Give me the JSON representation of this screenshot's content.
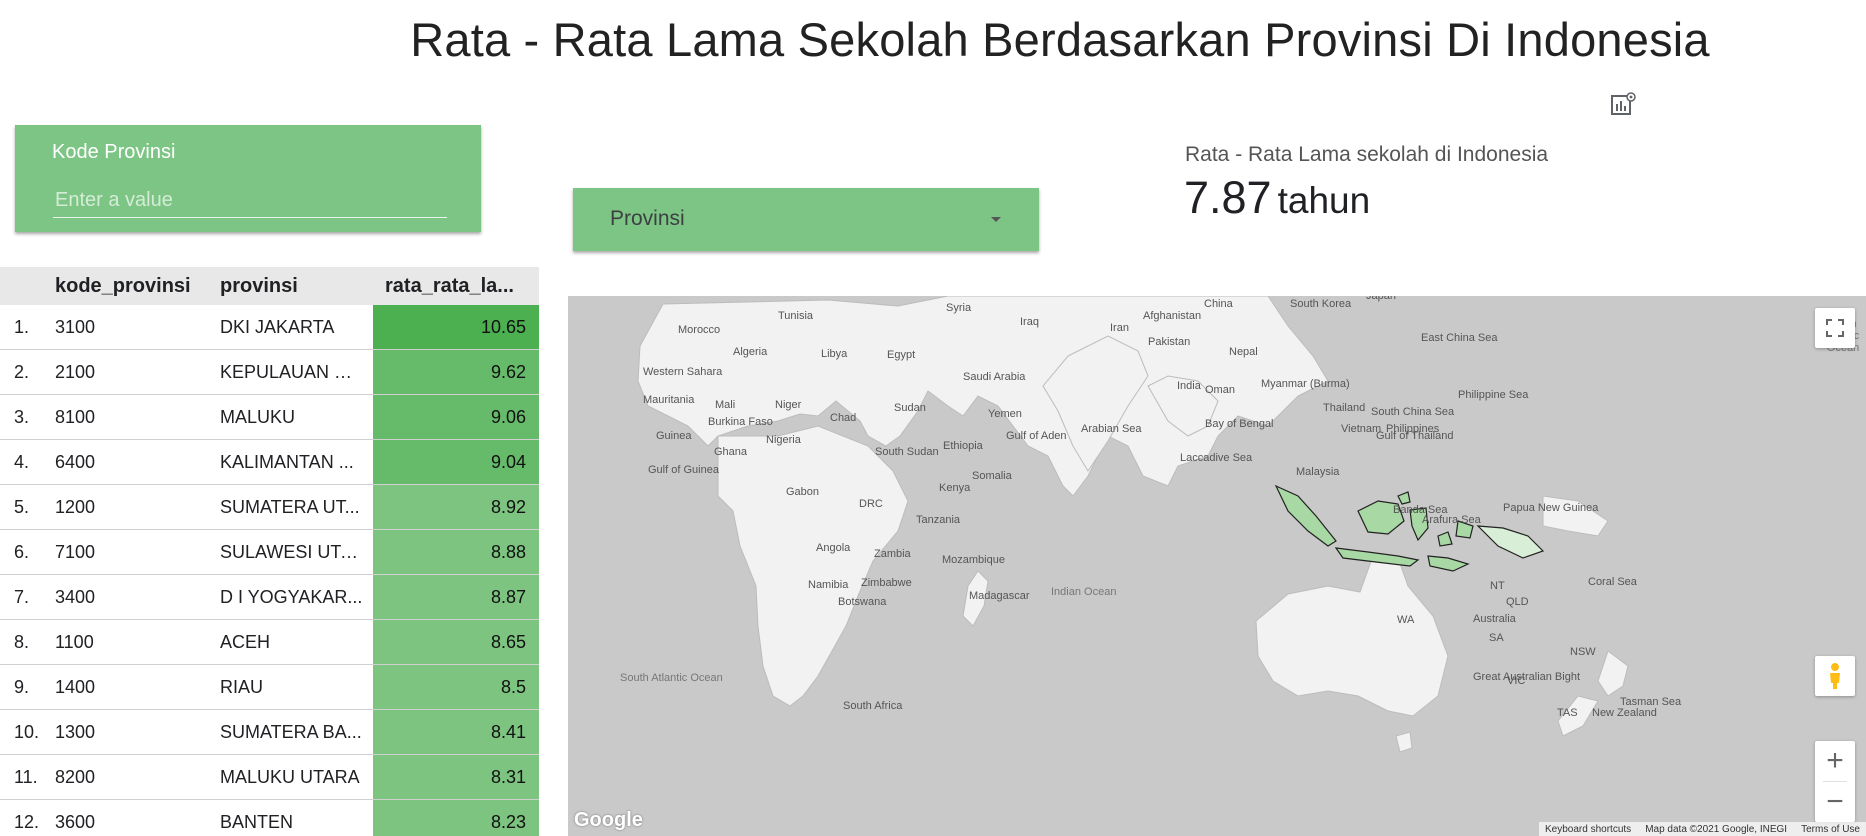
{
  "header": {
    "title": "Rata - Rata Lama Sekolah Berdasarkan Provinsi Di Indonesia",
    "report_icon": "chart-settings-icon"
  },
  "filter": {
    "label": "Kode Provinsi",
    "placeholder": "Enter a value"
  },
  "dropdown": {
    "label": "Provinsi",
    "icon": "dropdown-arrow-icon"
  },
  "scorecard": {
    "label": "Rata - Rata Lama sekolah di Indonesia",
    "value": "7.87",
    "unit": "tahun"
  },
  "table": {
    "columns": [
      "kode_provinsi",
      "provinsi",
      "rata_rata_la..."
    ],
    "rows": [
      {
        "idx": "1.",
        "kode": "3100",
        "prov": "DKI JAKARTA",
        "val": "10.65"
      },
      {
        "idx": "2.",
        "kode": "2100",
        "prov": "KEPULAUAN RI...",
        "val": "9.62"
      },
      {
        "idx": "3.",
        "kode": "8100",
        "prov": "MALUKU",
        "val": "9.06"
      },
      {
        "idx": "4.",
        "kode": "6400",
        "prov": "KALIMANTAN ...",
        "val": "9.04"
      },
      {
        "idx": "5.",
        "kode": "1200",
        "prov": "SUMATERA UT...",
        "val": "8.92"
      },
      {
        "idx": "6.",
        "kode": "7100",
        "prov": "SULAWESI UTA...",
        "val": "8.88"
      },
      {
        "idx": "7.",
        "kode": "3400",
        "prov": "D I YOGYAKAR...",
        "val": "8.87"
      },
      {
        "idx": "8.",
        "kode": "1100",
        "prov": "ACEH",
        "val": "8.65"
      },
      {
        "idx": "9.",
        "kode": "1400",
        "prov": "RIAU",
        "val": "8.5"
      },
      {
        "idx": "10.",
        "kode": "1300",
        "prov": "SUMATERA BA...",
        "val": "8.41"
      },
      {
        "idx": "11.",
        "kode": "8200",
        "prov": "MALUKU UTARA",
        "val": "8.31"
      },
      {
        "idx": "12.",
        "kode": "3600",
        "prov": "BANTEN",
        "val": "8.23"
      }
    ],
    "colors": {
      "top": "#4caf50",
      "mid": "#66bb6a",
      "low": "#7cc47f"
    }
  },
  "map": {
    "labels": [
      "China",
      "South Korea",
      "Japan",
      "Syria",
      "Iraq",
      "Iran",
      "Afghanistan",
      "Tunisia",
      "Morocco",
      "Pakistan",
      "Nepal",
      "East China Sea",
      "Algeria",
      "Libya",
      "Egypt",
      "Saudi Arabia",
      "India",
      "Myanmar (Burma)",
      "Western Sahara",
      "Oman",
      "Philippine Sea",
      "Mauritania",
      "Mali",
      "Niger",
      "Chad",
      "Sudan",
      "Yemen",
      "Thailand",
      "South China Sea",
      "Burkina Faso",
      "Guinea",
      "Nigeria",
      "Gulf of Aden",
      "Arabian Sea",
      "Bay of Bengal",
      "Vietnam",
      "Philippines",
      "Ghana",
      "South Sudan",
      "Ethiopia",
      "Gulf of Thailand",
      "Laccadive Sea",
      "Gulf of Guinea",
      "Somalia",
      "Malaysia",
      "Gabon",
      "Kenya",
      "DRC",
      "Papua New Guinea",
      "Tanzania",
      "Banda Sea",
      "Arafura Sea",
      "Angola",
      "Zambia",
      "Mozambique",
      "NT",
      "Coral Sea",
      "Namibia",
      "Zimbabwe",
      "QLD",
      "Madagascar",
      "Botswana",
      "Australia",
      "WA",
      "SA",
      "South Africa",
      "NSW",
      "Great Australian Bight",
      "VIC",
      "Tasman Sea",
      "TAS",
      "New Zealand"
    ],
    "oceans": [
      "Indian Ocean",
      "South Atlantic Ocean",
      "North Pacific Ocean"
    ],
    "google": "Google",
    "attribution": [
      "Keyboard shortcuts",
      "Map data ©2021 Google, INEGI",
      "Terms of Use"
    ],
    "zoom_in": "+",
    "zoom_out": "−"
  }
}
